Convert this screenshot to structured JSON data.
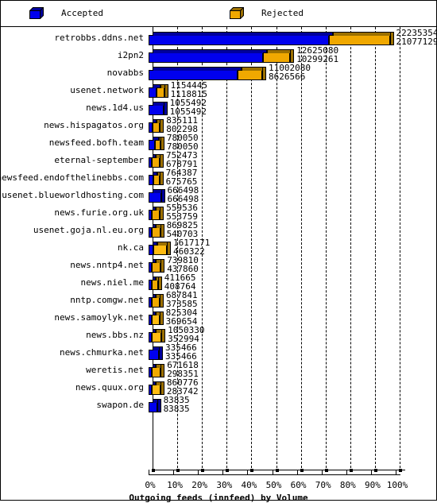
{
  "legend": {
    "items": [
      {
        "label": "Accepted",
        "color": "#0000ee",
        "icon": "cube-icon"
      },
      {
        "label": "Rejected",
        "color": "#f0a800",
        "icon": "cube-icon"
      }
    ]
  },
  "axis": {
    "title": "Outgoing feeds (innfeed) by Volume",
    "ticks": [
      "0%",
      "10%",
      "20%",
      "30%",
      "40%",
      "50%",
      "60%",
      "70%",
      "80%",
      "90%",
      "100%"
    ]
  },
  "chart_data": {
    "type": "bar",
    "orientation": "horizontal",
    "stacked": true,
    "title": "Outgoing feeds (innfeed) by Volume",
    "xlabel": "Outgoing feeds (innfeed) by Volume",
    "ylabel": "",
    "xlim": [
      0,
      100
    ],
    "xtick_labels": [
      "0%",
      "10%",
      "20%",
      "30%",
      "40%",
      "50%",
      "60%",
      "70%",
      "80%",
      "90%",
      "100%"
    ],
    "grid": true,
    "legend": [
      "Accepted",
      "Rejected"
    ],
    "legend_position": "top",
    "colors": {
      "accepted": "#0000ee",
      "rejected": "#f0a800",
      "accepted_shade": "#00009c",
      "rejected_shade": "#9c7000"
    },
    "categories": [
      "retrobbs.ddns.net",
      "i2pn2",
      "novabbs",
      "usenet.network",
      "news.1d4.us",
      "news.hispagatos.org",
      "newsfeed.bofh.team",
      "eternal-september",
      "newsfeed.endofthelinebbs.com",
      "usenet.blueworldhosting.com",
      "news.furie.org.uk",
      "usenet.goja.nl.eu.org",
      "nk.ca",
      "news.nntp4.net",
      "news.niel.me",
      "nntp.comgw.net",
      "news.samoylyk.net",
      "news.bbs.nz",
      "news.chmurka.net",
      "weretis.net",
      "news.quux.org",
      "swapon.de"
    ],
    "series": [
      {
        "name": "Accepted",
        "values": [
          22235354,
          12625080,
          11002080,
          1154445,
          1055492,
          835111,
          780050,
          752473,
          764387,
          666498,
          559536,
          869825,
          1617171,
          739810,
          411665,
          687841,
          825304,
          1050330,
          335466,
          671618,
          860776,
          83835
        ]
      },
      {
        "name": "Rejected",
        "values": [
          21077129,
          10299261,
          8626566,
          1118815,
          1055492,
          802298,
          780050,
          678791,
          675765,
          666498,
          553759,
          540703,
          460322,
          437860,
          408764,
          373585,
          369654,
          352994,
          335466,
          298351,
          283742,
          83835
        ]
      }
    ]
  },
  "rows": [
    {
      "label": "retrobbs.ddns.net",
      "accepted": "22235354",
      "rejected": "21077129",
      "acc_pct": 73.0,
      "rej_pct": 24.6,
      "bright": false
    },
    {
      "label": "i2pn2",
      "accepted": "12625080",
      "rejected": "10299261",
      "acc_pct": 46.2,
      "rej_pct": 11.1,
      "bright": false
    },
    {
      "label": "novabbs",
      "accepted": "11002080",
      "rejected": "8626566",
      "acc_pct": 36.1,
      "rej_pct": 9.9,
      "bright": false
    },
    {
      "label": "usenet.network",
      "accepted": "1154445",
      "rejected": "1118815",
      "acc_pct": 3.1,
      "rej_pct": 3.2,
      "bright": false
    },
    {
      "label": "news.1d4.us",
      "accepted": "1055492",
      "rejected": "1055492",
      "acc_pct": 6.0,
      "rej_pct": 0.0,
      "bright": false
    },
    {
      "label": "news.hispagatos.org",
      "accepted": "835111",
      "rejected": "802298",
      "acc_pct": 1.5,
      "rej_pct": 3.1,
      "bright": false
    },
    {
      "label": "newsfeed.bofh.team",
      "accepted": "780050",
      "rejected": "780050",
      "acc_pct": 2.5,
      "rej_pct": 2.3,
      "bright": false
    },
    {
      "label": "eternal-september",
      "accepted": "752473",
      "rejected": "678791",
      "acc_pct": 1.3,
      "rej_pct": 3.2,
      "bright": false
    },
    {
      "label": "newsfeed.endofthelinebbs.com",
      "accepted": "764387",
      "rejected": "675765",
      "acc_pct": 1.8,
      "rej_pct": 2.6,
      "bright": false
    },
    {
      "label": "usenet.blueworldhosting.com",
      "accepted": "666498",
      "rejected": "666498",
      "acc_pct": 5.0,
      "rej_pct": 0.0,
      "bright": false
    },
    {
      "label": "news.furie.org.uk",
      "accepted": "559536",
      "rejected": "553759",
      "acc_pct": 1.3,
      "rej_pct": 3.3,
      "bright": false
    },
    {
      "label": "usenet.goja.nl.eu.org",
      "accepted": "869825",
      "rejected": "540703",
      "acc_pct": 1.1,
      "rej_pct": 3.4,
      "bright": false
    },
    {
      "label": "nk.ca",
      "accepted": "1617171",
      "rejected": "460322",
      "acc_pct": 1.8,
      "rej_pct": 5.6,
      "bright": true
    },
    {
      "label": "news.nntp4.net",
      "accepted": "739810",
      "rejected": "437860",
      "acc_pct": 0.8,
      "rej_pct": 3.6,
      "bright": false
    },
    {
      "label": "news.niel.me",
      "accepted": "411665",
      "rejected": "408764",
      "acc_pct": 0.9,
      "rej_pct": 2.5,
      "bright": false
    },
    {
      "label": "nntp.comgw.net",
      "accepted": "687841",
      "rejected": "373585",
      "acc_pct": 0.9,
      "rej_pct": 3.2,
      "bright": false
    },
    {
      "label": "news.samoylyk.net",
      "accepted": "825304",
      "rejected": "369654",
      "acc_pct": 1.4,
      "rej_pct": 3.0,
      "bright": true
    },
    {
      "label": "news.bbs.nz",
      "accepted": "1050330",
      "rejected": "352994",
      "acc_pct": 1.3,
      "rej_pct": 3.9,
      "bright": true
    },
    {
      "label": "news.chmurka.net",
      "accepted": "335466",
      "rejected": "335466",
      "acc_pct": 4.2,
      "rej_pct": 0.0,
      "bright": false
    },
    {
      "label": "weretis.net",
      "accepted": "671618",
      "rejected": "298351",
      "acc_pct": 0.9,
      "rej_pct": 3.6,
      "bright": false
    },
    {
      "label": "news.quux.org",
      "accepted": "860776",
      "rejected": "283742",
      "acc_pct": 1.4,
      "rej_pct": 3.4,
      "bright": true
    },
    {
      "label": "swapon.de",
      "accepted": "83835",
      "rejected": "83835",
      "acc_pct": 3.4,
      "rej_pct": 0.0,
      "bright": false
    }
  ]
}
